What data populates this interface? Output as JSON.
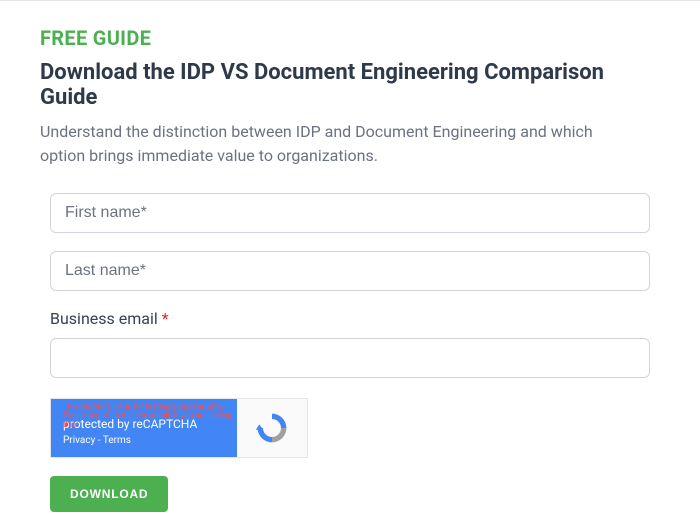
{
  "eyebrow": "FREE GUIDE",
  "heading": "Download the IDP VS Document Engineering Comparison Guide",
  "subheading": "Understand the distinction between IDP and Document Engineering and which option brings immediate value to organizations.",
  "form": {
    "first_name": {
      "placeholder": "First name*",
      "value": ""
    },
    "last_name": {
      "placeholder": "Last name*",
      "value": ""
    },
    "business_email": {
      "label": "Business email",
      "required_mark": "*",
      "value": ""
    },
    "submit_label": "DOWNLOAD"
  },
  "recaptcha": {
    "warning": "This reCAPTCHA is for testing purposes only. Please report to the site admin if you are seeing this.",
    "title": "protected by reCAPTCHA",
    "privacy": "Privacy",
    "separator": " - ",
    "terms": "Terms"
  }
}
